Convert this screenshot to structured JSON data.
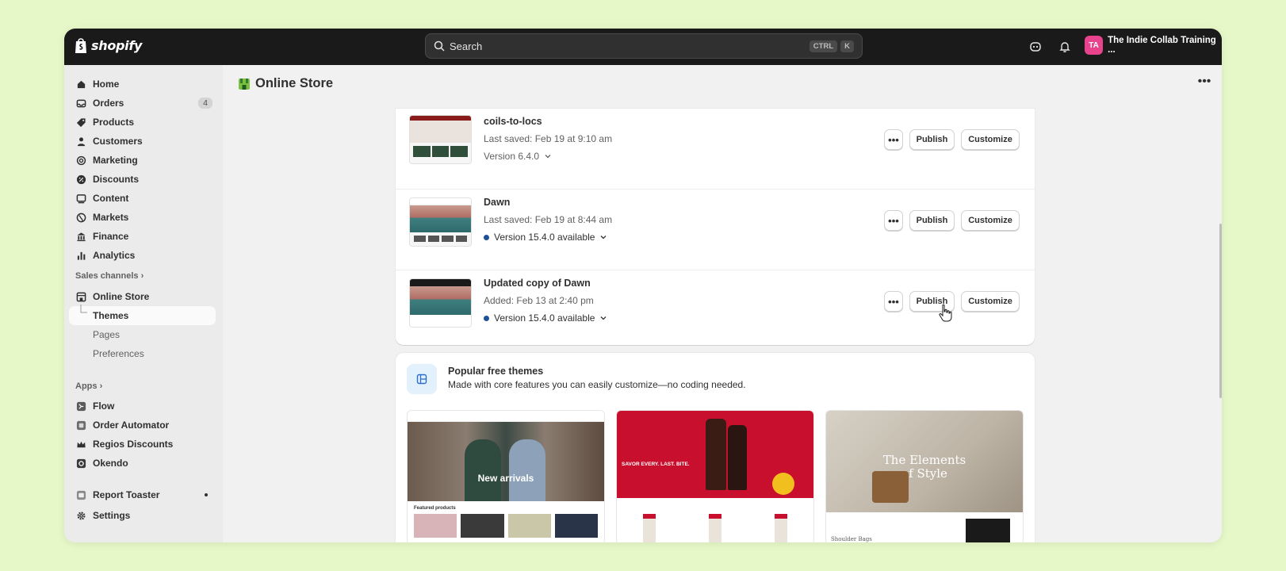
{
  "topbar": {
    "brand": "shopify",
    "search_placeholder": "Search",
    "kbd_ctrl": "CTRL",
    "kbd_k": "K",
    "avatar_initials": "TA",
    "store_name": "The Indie Collab Training ..."
  },
  "sidebar": {
    "items": [
      {
        "label": "Home",
        "icon": "home-icon"
      },
      {
        "label": "Orders",
        "icon": "inbox-icon",
        "badge": "4"
      },
      {
        "label": "Products",
        "icon": "tag-icon"
      },
      {
        "label": "Customers",
        "icon": "person-icon"
      },
      {
        "label": "Marketing",
        "icon": "target-icon"
      },
      {
        "label": "Discounts",
        "icon": "discount-icon"
      },
      {
        "label": "Content",
        "icon": "image-icon"
      },
      {
        "label": "Markets",
        "icon": "globe-icon"
      },
      {
        "label": "Finance",
        "icon": "bank-icon"
      },
      {
        "label": "Analytics",
        "icon": "bar-chart-icon"
      }
    ],
    "sales_channels_label": "Sales channels",
    "online_store": "Online Store",
    "themes": "Themes",
    "pages": "Pages",
    "preferences": "Preferences",
    "apps_label": "Apps",
    "apps": [
      {
        "label": "Flow",
        "icon": "flow-app-icon"
      },
      {
        "label": "Order Automator",
        "icon": "order-automator-app-icon"
      },
      {
        "label": "Regios Discounts",
        "icon": "crown-icon"
      },
      {
        "label": "Okendo",
        "icon": "okendo-app-icon"
      }
    ],
    "report_toaster": "Report Toaster",
    "settings": "Settings"
  },
  "page": {
    "title": "Online Store"
  },
  "themes": [
    {
      "name": "coils-to-locs",
      "saved": "Last saved: Feb 19 at 9:10 am",
      "version": "Version 6.4.0",
      "update_available": false
    },
    {
      "name": "Dawn",
      "saved": "Last saved: Feb 19 at 8:44 am",
      "version": "Version 15.4.0 available",
      "update_available": true
    },
    {
      "name": "Updated copy of Dawn",
      "saved": "Added: Feb 13 at 2:40 pm",
      "version": "Version 15.4.0 available",
      "update_available": true
    }
  ],
  "buttons": {
    "more": "•••",
    "publish": "Publish",
    "customize": "Customize"
  },
  "popular": {
    "title": "Popular free themes",
    "subtitle": "Made with core features you can easily customize—no coding needed.",
    "previews": [
      {
        "caption": "New arrivals",
        "section": "Featured products"
      },
      {
        "caption": "SAVOR EVERY. LAST. BITE."
      },
      {
        "caption": "The Elements of Style",
        "section": "Shoulder Bags"
      }
    ]
  },
  "colors": {
    "topbar": "#1a1a1a",
    "accent_avatar": "#e8438c",
    "background": "#e6f8c8",
    "version_dot": "#1f5199"
  }
}
